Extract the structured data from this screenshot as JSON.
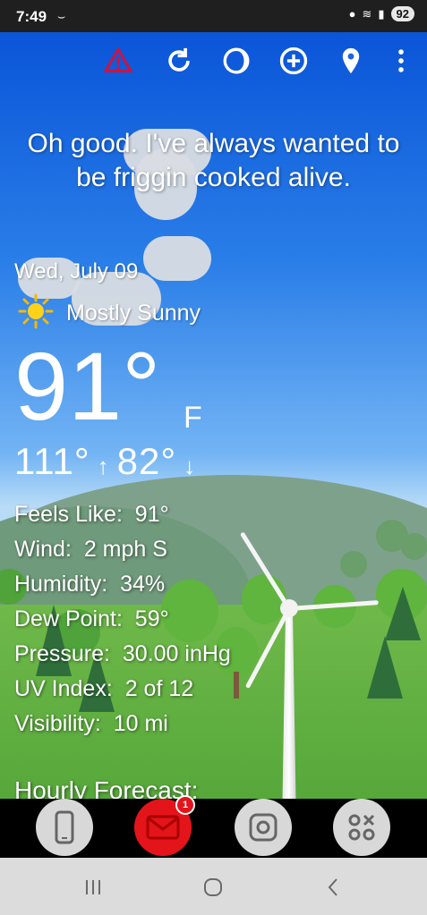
{
  "status_bar": {
    "time": "7:49",
    "battery": "92"
  },
  "quote": "Oh good. I've always wanted to be friggin cooked alive.",
  "date": "Wed, July 09",
  "condition": "Mostly Sunny",
  "temperature": "91°",
  "unit": "F",
  "high": "111°",
  "low": "82°",
  "details": [
    {
      "label": "Feels Like:",
      "value": "91°"
    },
    {
      "label": "Wind:",
      "value": "2 mph S"
    },
    {
      "label": "Humidity:",
      "value": "34%"
    },
    {
      "label": "Dew Point:",
      "value": "59°"
    },
    {
      "label": "Pressure:",
      "value": "30.00 inHg"
    },
    {
      "label": "UV Index:",
      "value": "2 of 12"
    },
    {
      "label": "Visibility:",
      "value": "10 mi"
    }
  ],
  "hourly_heading": "Hourly Forecast:",
  "dock": {
    "messages_badge": "1"
  },
  "colors": {
    "alert": "#d6103a",
    "accent_red": "#e4141b",
    "sky": "#0a55d8"
  },
  "icons": [
    "warning-icon",
    "refresh-icon",
    "moon-phase-icon",
    "add-location-icon",
    "map-pin-icon",
    "more-vert-icon",
    "sun-icon",
    "phone-icon",
    "mail-icon",
    "camera-icon",
    "apps-icon"
  ]
}
